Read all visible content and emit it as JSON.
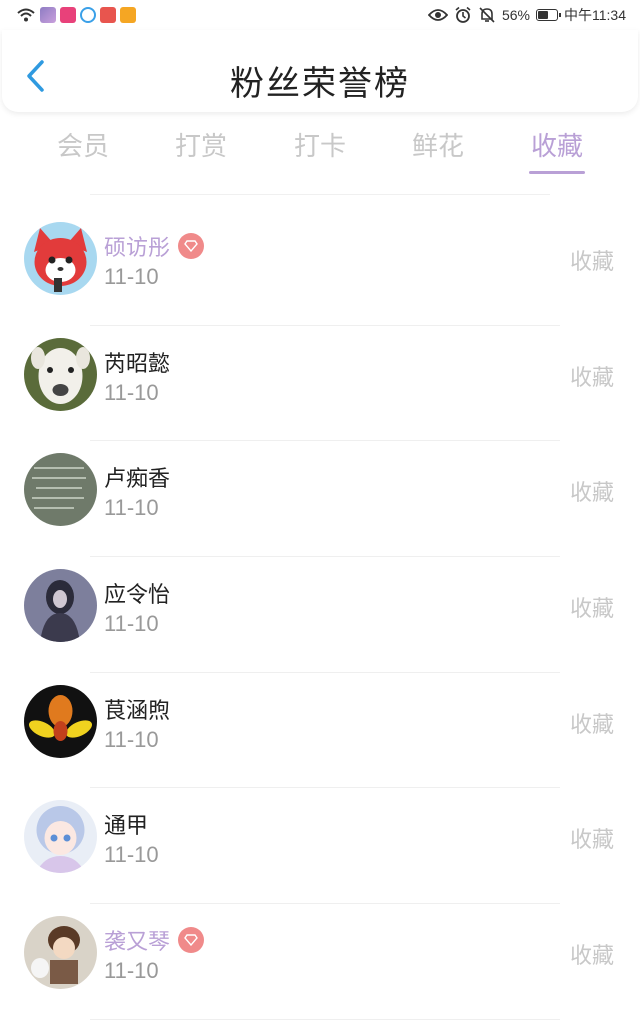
{
  "statusbar": {
    "battery_percent": "56%",
    "battery_level": 0.56,
    "time": "中午11:34",
    "left_icons": [
      "wifi-icon",
      "app-icon-1",
      "app-icon-2",
      "app-icon-3",
      "app-icon-4",
      "app-icon-5"
    ],
    "right_icons": [
      "eye-icon",
      "alarm-icon",
      "mute-icon",
      "battery-icon"
    ]
  },
  "header": {
    "title": "粉丝荣誉榜",
    "back_icon": "chevron-left-icon"
  },
  "colors": {
    "accent": "#b9a0d6",
    "back_arrow": "#2f9ae0",
    "inactive_tab": "#c8c8c8",
    "vip_badge": "#f08a8a"
  },
  "tabs": [
    {
      "label": "会员",
      "active": false
    },
    {
      "label": "打赏",
      "active": false
    },
    {
      "label": "打卡",
      "active": false
    },
    {
      "label": "鲜花",
      "active": false
    },
    {
      "label": "收藏",
      "active": true
    }
  ],
  "list": [
    {
      "name": "硕访彤",
      "date": "11-10",
      "vip": true,
      "action": "收藏"
    },
    {
      "name": "芮昭懿",
      "date": "11-10",
      "vip": false,
      "action": "收藏"
    },
    {
      "name": "卢痴香",
      "date": "11-10",
      "vip": false,
      "action": "收藏"
    },
    {
      "name": "应令怡",
      "date": "11-10",
      "vip": false,
      "action": "收藏"
    },
    {
      "name": "茛涵煦",
      "date": "11-10",
      "vip": false,
      "action": "收藏"
    },
    {
      "name": "通甲",
      "date": "11-10",
      "vip": false,
      "action": "收藏"
    },
    {
      "name": "袭又琴",
      "date": "11-10",
      "vip": true,
      "action": "收藏"
    }
  ]
}
